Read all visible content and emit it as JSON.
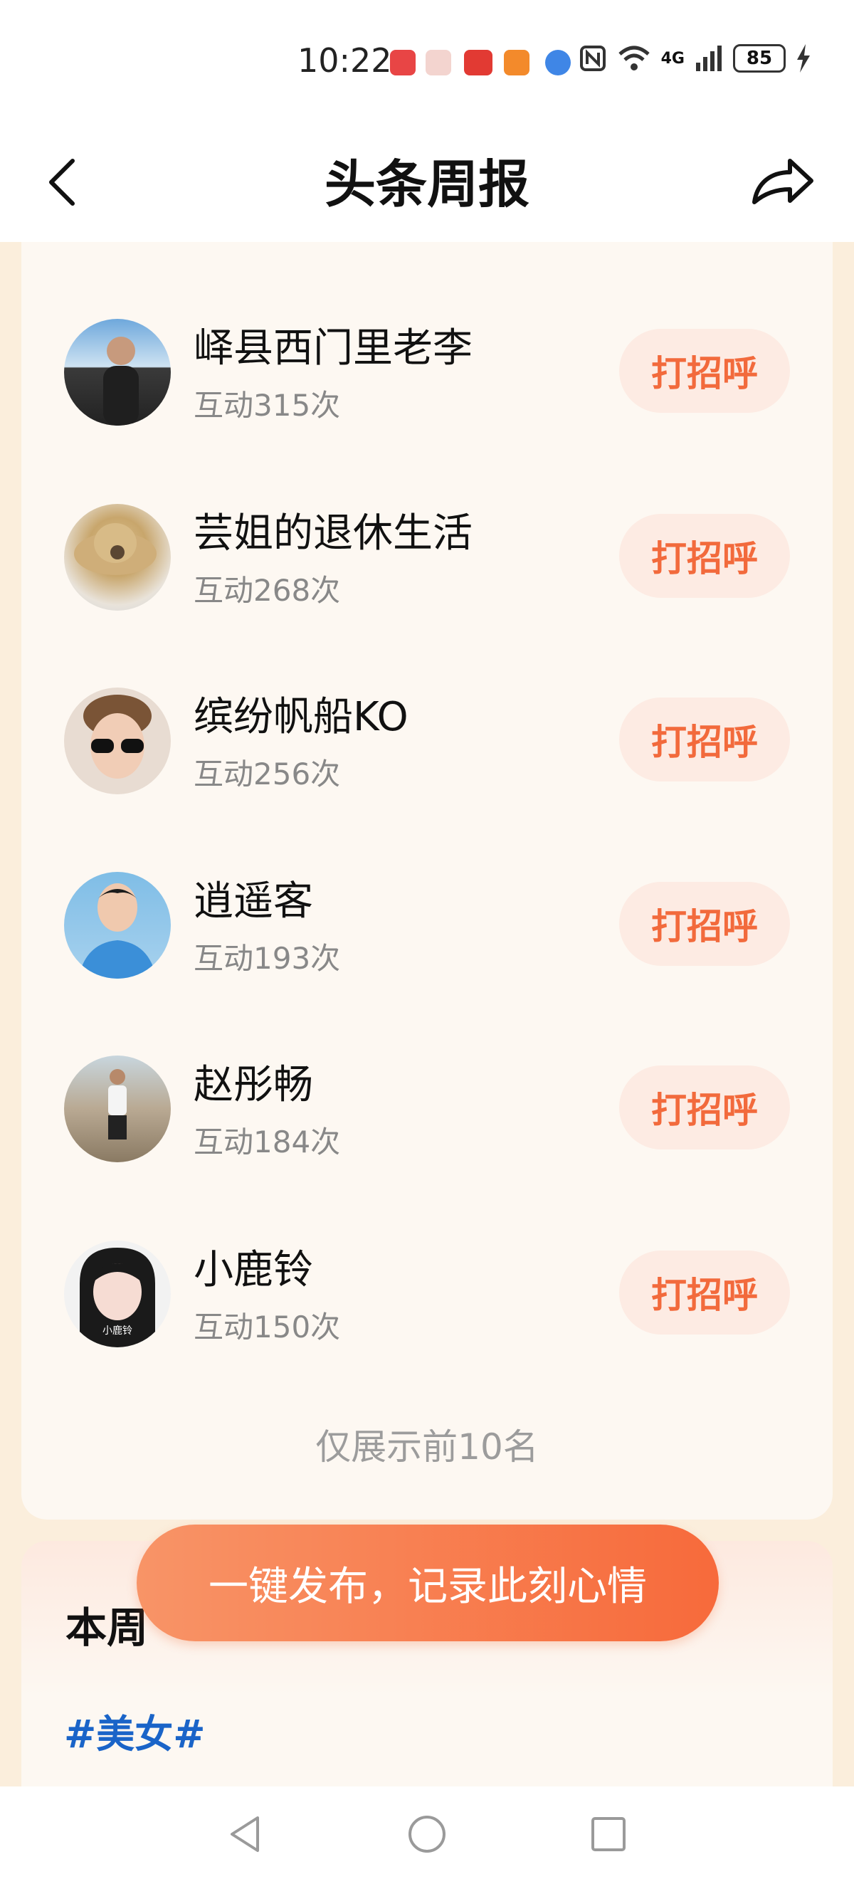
{
  "status_bar": {
    "time": "10:22",
    "network": "4G",
    "battery": "85",
    "app_icons": [
      "huawei-icon",
      "package-icon",
      "toutiao-icon",
      "orange-app-icon",
      "browser-icon"
    ]
  },
  "header": {
    "title": "头条周报",
    "back_icon": "chevron-left-icon",
    "share_icon": "share-arrow-icon"
  },
  "interactions": [
    {
      "name": "峄县西门里老李",
      "count": "互动315次",
      "button": "打招呼"
    },
    {
      "name": "芸姐的退休生活",
      "count": "互动268次",
      "button": "打招呼"
    },
    {
      "name": "缤纷帆船KO",
      "count": "互动256次",
      "button": "打招呼"
    },
    {
      "name": "逍遥客",
      "count": "互动193次",
      "button": "打招呼"
    },
    {
      "name": "赵彤畅",
      "count": "互动184次",
      "button": "打招呼"
    },
    {
      "name": "小鹿铃",
      "count": "互动150次",
      "button": "打招呼"
    }
  ],
  "footnote": "仅展示前10名",
  "section": {
    "title_partial": "本周",
    "hashtag": "#美女#"
  },
  "publish_button": "一键发布，记录此刻心情",
  "avatar_watermark": "小鹿铃",
  "colors": {
    "accent": "#f26a3c",
    "page_bg": "#fbeedc",
    "card_bg": "#fdf8f2",
    "hashtag": "#1a64c8"
  }
}
